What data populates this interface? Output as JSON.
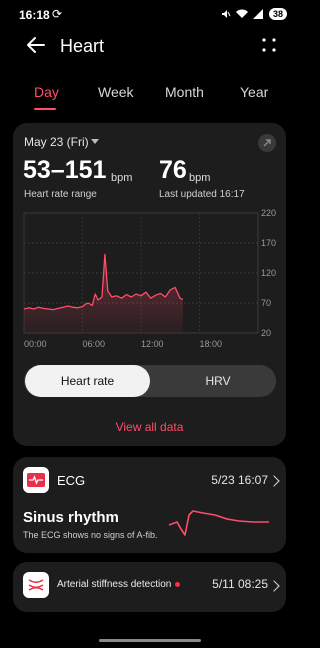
{
  "status_bar": {
    "time": "16:18",
    "battery": "38"
  },
  "app_bar": {
    "title": "Heart"
  },
  "tabs": [
    {
      "label": "Day",
      "active": true
    },
    {
      "label": "Week",
      "active": false
    },
    {
      "label": "Month",
      "active": false
    },
    {
      "label": "Year",
      "active": false
    }
  ],
  "summary": {
    "date": "May 23 (Fri)",
    "range_value": "53–151",
    "range_unit": "bpm",
    "range_label": "Heart rate range",
    "last_value": "76",
    "last_unit": "bpm",
    "last_label": "Last updated 16:17"
  },
  "chart_data": {
    "type": "line",
    "x_ticks": [
      "00:00",
      "06:00",
      "12:00",
      "18:00"
    ],
    "y_ticks": [
      20,
      70,
      120,
      170,
      220
    ],
    "ylim": [
      20,
      220
    ],
    "xlim_hours": [
      0,
      24
    ],
    "series": [
      {
        "color": "#ff4d6a",
        "x": [
          0,
          0.5,
          1,
          1.5,
          2,
          2.5,
          3,
          3.5,
          4,
          4.5,
          5,
          5.5,
          6,
          6.3,
          6.6,
          7,
          7.3,
          7.6,
          8,
          8.3,
          8.6,
          9,
          9.5,
          10,
          10.5,
          11,
          11.5,
          12,
          12.5,
          13,
          13.5,
          14,
          14.5,
          15,
          15.5,
          16,
          16.3
        ],
        "y": [
          60,
          62,
          60,
          63,
          61,
          60,
          59,
          61,
          63,
          65,
          63,
          62,
          64,
          68,
          70,
          66,
          85,
          75,
          80,
          151,
          90,
          80,
          82,
          78,
          84,
          80,
          85,
          82,
          88,
          78,
          83,
          86,
          80,
          92,
          96,
          78,
          76
        ]
      }
    ]
  },
  "segmented": {
    "active_label": "Heart rate",
    "inactive_label": "HRV"
  },
  "view_all": "View all data",
  "ecg": {
    "title": "ECG",
    "time": "5/23 16:07",
    "result": "Sinus rhythm",
    "subtitle": "The ECG shows no signs of A-fib."
  },
  "arterial": {
    "title": "Arterial stiffness detection",
    "time": "5/11 08:25"
  },
  "colors": {
    "accent": "#ff4d6a",
    "card": "#1d1d1d",
    "background": "#000000"
  }
}
